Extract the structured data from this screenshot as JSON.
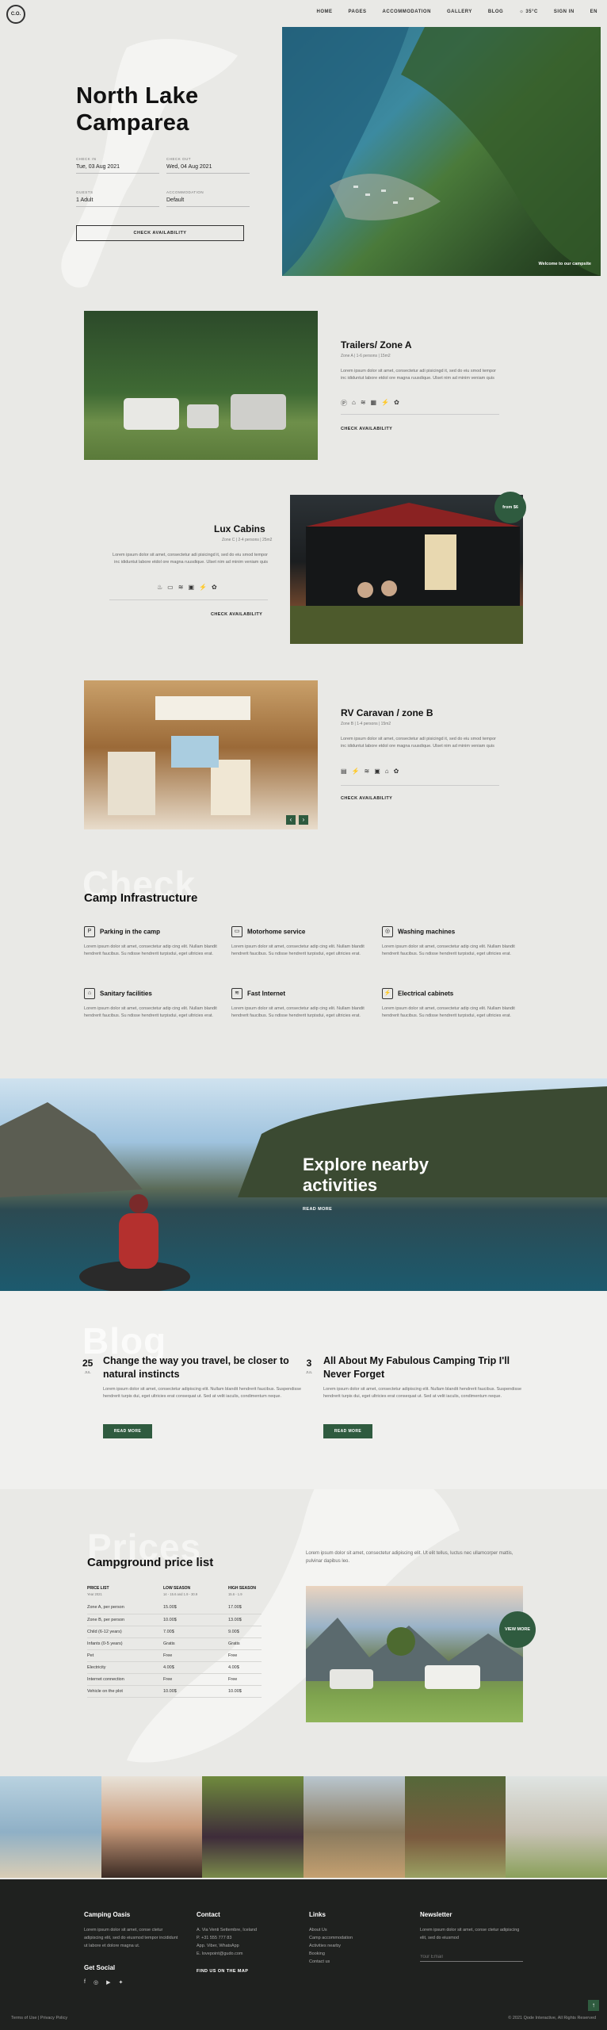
{
  "nav": {
    "logo": "C.O.",
    "items": [
      "HOME",
      "PAGES",
      "ACCOMMODATION",
      "GALLERY",
      "BLOG",
      "☼ 35°C",
      "SIGN IN",
      "EN"
    ]
  },
  "hero": {
    "title_line1": "North Lake",
    "title_line2": "Camparea",
    "checkin_label": "CHECK IN",
    "checkin_value": "Tue, 03 Aug 2021",
    "checkout_label": "CHECK OUT",
    "checkout_value": "Wed, 04 Aug 2021",
    "guests_label": "GUESTS",
    "guests_value": "1 Adult",
    "accommodation_label": "ACCOMMODATION",
    "accommodation_value": "Default",
    "button": "CHECK AVAILABILITY",
    "photo_caption": "Welcome to our campsite"
  },
  "rooms": [
    {
      "title": "Trailers/ Zone A",
      "sub": "Zone A | 1-6 persons | 15m2",
      "desc": "Lorem ipsum dolor sit amet, consectetur adi pisicingd it, sed do eiu smod tempor inc ididuntut labore etdol ore magna ruusdique. Ulset nim ad minim veniam quis",
      "cta": "CHECK AVAILABILITY"
    },
    {
      "title": "Lux Cabins",
      "sub": "Zone C | 2-4 persons | 25m2",
      "desc": "Lorem ipsum dolor sit amet, consectetur adi pisicingd it, sed do eiu smod tempor inc ididuntut labore etdol ore magna ruusdique. Ulset nim ad minim veniam quis",
      "cta": "CHECK AVAILABILITY",
      "badge": "from $6"
    },
    {
      "title": "RV Caravan / zone B",
      "sub": "Zone B | 1-4 persons | 15m2",
      "desc": "Lorem ipsum dolor sit amet, consectetur adi pisicingd it, sed do eiu smod tempor inc ididuntut labore etdol ore magna ruusdique. Ulset nim ad minim veniam quis",
      "cta": "CHECK AVAILABILITY"
    }
  ],
  "infra": {
    "ghost": "Check",
    "title": "Camp Infrastructure",
    "desc": "Lorem ipsum dolor sit amet, consectetur adip cing elit. Nullam blandit hendrerit faucibus. Su ndisse hendrerit turpisdui, eget ultricies erat.",
    "items": [
      "Parking in the camp",
      "Motorhome service",
      "Washing machines",
      "Sanitary facilities",
      "Fast Internet",
      "Electrical cabinets"
    ]
  },
  "explore": {
    "title_line1": "Explore nearby",
    "title_line2": "activities",
    "cta": "READ MORE"
  },
  "blog": {
    "ghost": "Blog",
    "posts": [
      {
        "day": "25",
        "month": "JUL",
        "title": "Change the way you travel, be closer to natural instincts",
        "text": "Lorem ipsum dolor sit amet, consectetur adipiscing elit. Nullam blandit hendrerit faucibus. Suspendisse hendrerit turpis dui, eget ultricies erat consequat ut. Sed at velit iaculis, condimentum neque.",
        "cta": "READ MORE"
      },
      {
        "day": "3",
        "month": "JUL",
        "title": "All About My Fabulous Camping Trip I'll Never Forget",
        "text": "Lorem ipsum dolor sit amet, consectetur adipiscing elit. Nullam blandit hendrerit faucibus. Suspendisse hendrerit turpis dui, eget ultricies erat consequat ut. Sed at velit iaculis, condimentum neque.",
        "cta": "READ MORE"
      }
    ]
  },
  "prices": {
    "ghost": "Prices",
    "title": "Campground price list",
    "intro": "Lorem ipsum dolor sit amet, consectetur adipiscing elit. Ut elit tellus, luctus nec ullamcorper mattis, pulvinar dapibus leo.",
    "headers": [
      {
        "t": "PRICE LIST",
        "s": "Year 2021"
      },
      {
        "t": "LOW SEASON",
        "s": "14 - 15.6 and 1.9 - 30.9"
      },
      {
        "t": "HIGH SEASON",
        "s": "15.6 - 1.9"
      }
    ],
    "rows": [
      [
        "Zone A, per person",
        "15.00$",
        "17.00$"
      ],
      [
        "Zone B, per person",
        "10.00$",
        "13.00$"
      ],
      [
        "Child (6-12 years)",
        "7.00$",
        "9.00$"
      ],
      [
        "Infants (0-5 years)",
        "Gratis",
        "Gratis"
      ],
      [
        "Pet",
        "Free",
        "Free"
      ],
      [
        "Electricity",
        "4.00$",
        "4.00$"
      ],
      [
        "Internet connection",
        "Free",
        "Free"
      ],
      [
        "Vehicle on the plot",
        "10.00$",
        "10.00$"
      ]
    ],
    "badge": "VIEW MORE"
  },
  "footer": {
    "col1_title": "Camping Oasis",
    "col1_text": "Lorem ipsum dolor sit amet, conse ctetur adipiscing elit, sed do eiusmod tempor incididunt ut labore et dolore magna ut.",
    "social_title": "Get Social",
    "contact_title": "Contact",
    "contact_lines": [
      "A. Via Venti Settembre, Iceland",
      "P. +31 555 777 83",
      "App. Viber, WhatsApp",
      "E. lovepoint@gudo.com"
    ],
    "map_link": "FIND US ON THE MAP",
    "links_title": "Links",
    "links": [
      "About Us",
      "Camp accommodation",
      "Activities nearby",
      "Booking",
      "Contact us"
    ],
    "news_title": "Newsletter",
    "news_text": "Lorem ipsum dolor sit amet, conse ctetur adipiscing elit, sed do eiusmod",
    "email_placeholder": "Your Email",
    "bottom_left": "Terms of Use | Privacy Policy",
    "bottom_right": "© 2021 Qode Interactive, All Rights Reserved"
  }
}
